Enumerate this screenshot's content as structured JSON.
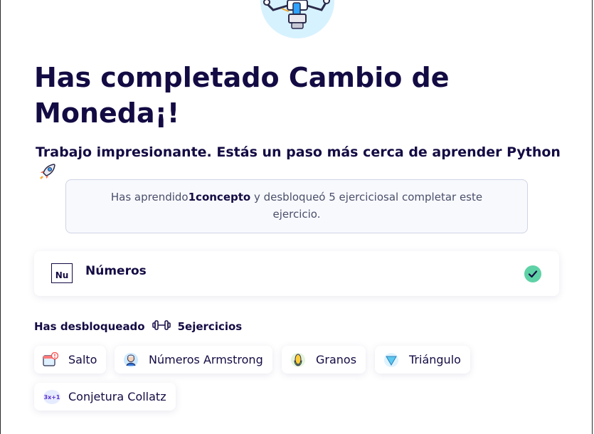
{
  "header": {
    "title": "Has completado Cambio de Moneda¡!",
    "subtitle": "Trabajo impresionante. Estás un paso más cerca de aprender Python"
  },
  "summary": {
    "prefix": "Has aprendido",
    "count": "1",
    "concept_word": "concepto",
    "middle": " y desbloqueó 5 ejercicios",
    "suffix": "al completar este ejercicio."
  },
  "concept": {
    "badge": "Nu",
    "name": "Números",
    "status_icon": "check-icon"
  },
  "unlocked": {
    "label": "Has desbloqueado",
    "count": "5",
    "count_word": "ejercicios"
  },
  "exercises": [
    {
      "name": "Salto",
      "icon": "calendar-alert-icon"
    },
    {
      "name": "Números Armstrong",
      "icon": "scientist-icon"
    },
    {
      "name": "Granos",
      "icon": "corn-icon"
    },
    {
      "name": "Triángulo",
      "icon": "triangle-icon"
    },
    {
      "name": "Conjetura Collatz",
      "icon": "formula-icon",
      "icon_text": "3x+1"
    }
  ],
  "colors": {
    "primary_text": "#130b43",
    "success": "#5ed2a6",
    "robot_bg": "#d7f2ff"
  }
}
